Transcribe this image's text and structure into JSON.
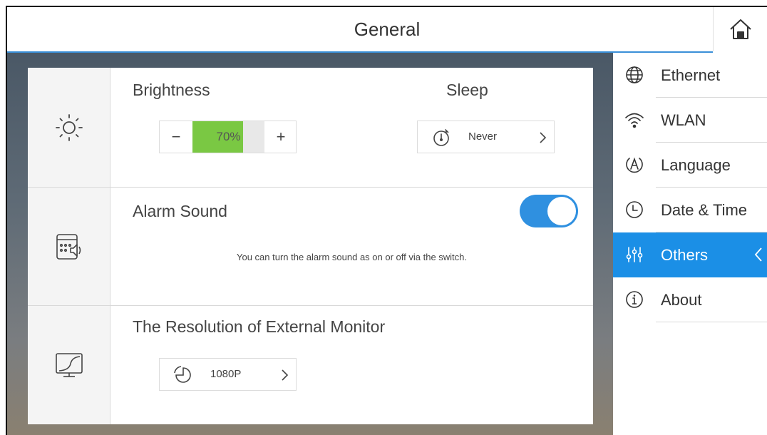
{
  "header": {
    "title": "General",
    "home_icon": "home-icon"
  },
  "brightness": {
    "title": "Brightness",
    "value_label": "70%",
    "value_fraction": 0.7,
    "minus_label": "−",
    "plus_label": "+",
    "row_icon": "sun-icon"
  },
  "sleep": {
    "title": "Sleep",
    "value": "Never",
    "icon": "timer-icon"
  },
  "alarm": {
    "title": "Alarm Sound",
    "enabled": true,
    "description": "You can turn the alarm sound as on or off via the switch.",
    "row_icon": "alarm-speaker-icon"
  },
  "resolution": {
    "title": "The Resolution of External Monitor",
    "value": "1080P",
    "row_icon": "monitor-curve-icon",
    "select_icon": "pie-icon"
  },
  "sidebar": {
    "items": [
      {
        "label": "Ethernet",
        "icon": "globe-icon",
        "active": false
      },
      {
        "label": "WLAN",
        "icon": "wifi-icon",
        "active": false
      },
      {
        "label": "Language",
        "icon": "language-icon",
        "active": false
      },
      {
        "label": "Date & Time",
        "icon": "clock-icon",
        "active": false
      },
      {
        "label": "Others",
        "icon": "sliders-icon",
        "active": true
      },
      {
        "label": "About",
        "icon": "info-icon",
        "active": false
      }
    ]
  },
  "colors": {
    "accent": "#1b8fe6",
    "toggle_on": "#2f90e0",
    "brightness_fill": "#7ac843"
  }
}
